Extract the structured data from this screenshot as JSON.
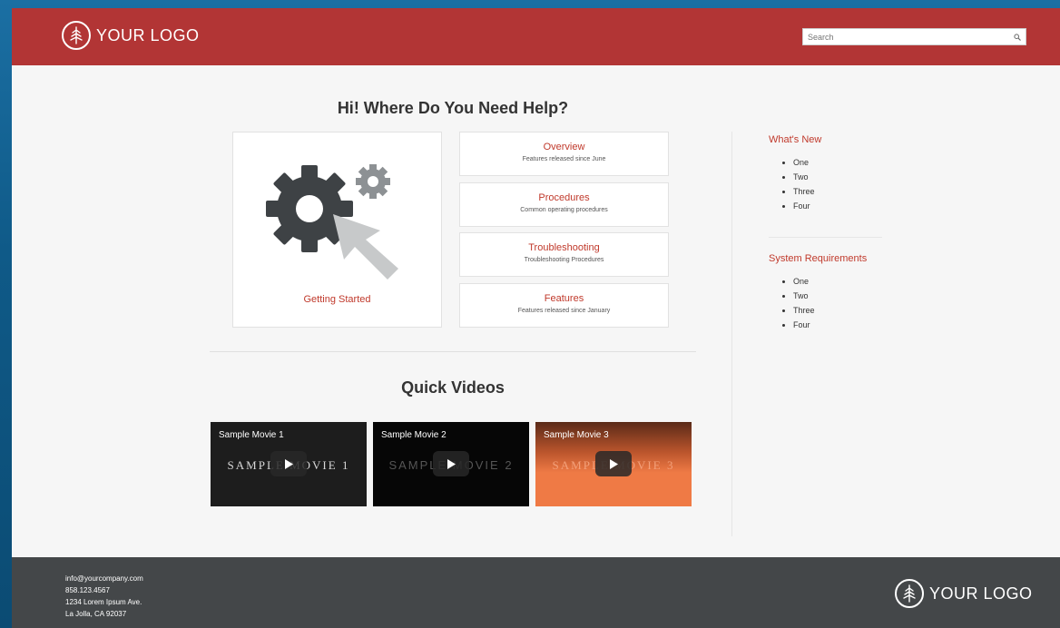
{
  "header": {
    "logo_text": "YOUR LOGO",
    "search_placeholder": "Search"
  },
  "main": {
    "title": "Hi! Where Do You Need Help?",
    "getting_started": "Getting Started",
    "topics": [
      {
        "title": "Overview",
        "subtitle": "Features released since June"
      },
      {
        "title": "Procedures",
        "subtitle": "Common operating procedures"
      },
      {
        "title": "Troubleshooting",
        "subtitle": "Troubleshooting Procedures"
      },
      {
        "title": "Features",
        "subtitle": "Features released since January"
      }
    ],
    "videos_title": "Quick Videos",
    "videos": [
      {
        "title": "Sample Movie 1",
        "watermark": "SAMPLE MOVIE 1"
      },
      {
        "title": "Sample Movie 2",
        "watermark": "SAMPLE MOVIE 2"
      },
      {
        "title": "Sample Movie 3",
        "watermark": "SAMPLE MOVIE 3"
      }
    ]
  },
  "sidebar": {
    "whats_new": {
      "title": "What's New",
      "items": [
        "One",
        "Two",
        "Three",
        "Four"
      ]
    },
    "system_requirements": {
      "title": "System Requirements",
      "items": [
        "One",
        "Two",
        "Three",
        "Four"
      ]
    }
  },
  "footer": {
    "email": "info@yourcompany.com",
    "phone": "858.123.4567",
    "address1": "1234 Lorem Ipsum Ave.",
    "address2": "La Jolla, CA 92037",
    "logo_text": "YOUR LOGO"
  },
  "colors": {
    "brand_red": "#b23535",
    "link_red": "#c0392b",
    "footer_gray": "#444749",
    "video3_orange": "#ef7a45"
  },
  "icons": [
    "logo-tree-icon",
    "search-icon",
    "gear-icon",
    "cursor-arrow-icon",
    "play-icon"
  ]
}
